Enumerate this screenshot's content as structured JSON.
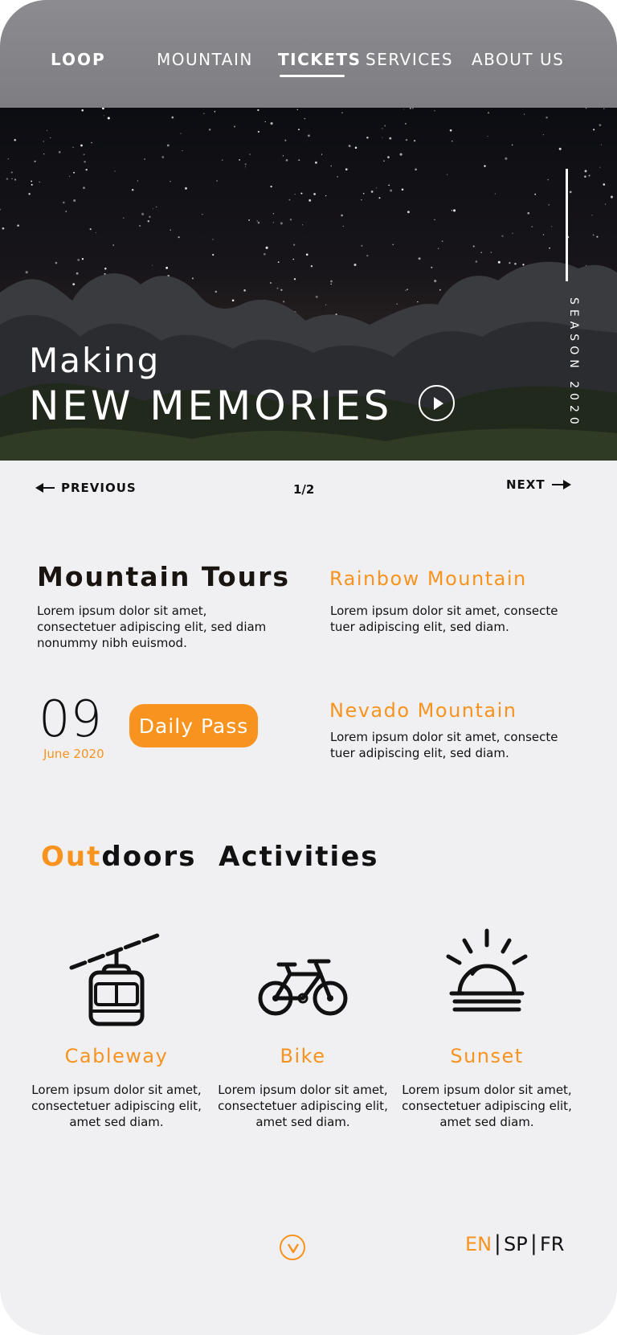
{
  "header": {
    "brand": "LOOP",
    "nav": [
      "MOUNTAIN",
      "TICKETS",
      "SERVICES",
      "ABOUT US"
    ],
    "active_nav": "TICKETS"
  },
  "hero": {
    "kicker": "Making",
    "title": "NEW MEMORIES",
    "season": "SEASON 2020"
  },
  "pager": {
    "previous": "PREVIOUS",
    "count": "1/2",
    "next": "NEXT"
  },
  "tours": {
    "title": "Mountain Tours",
    "text": "Lorem ipsum dolor sit amet, consectetuer adipiscing elit, sed diam nonummy nibh euismod.",
    "rainbow_title": "Rainbow Mountain",
    "rainbow_text": "Lorem ipsum dolor sit amet, consecte tuer adipiscing elit, sed diam.",
    "nevado_title": "Nevado Mountain",
    "nevado_text": "Lorem ipsum dolor sit amet, consecte tuer adipiscing elit, sed diam.",
    "date_day": "09",
    "date_month": "June 2020",
    "daily_pass": "Daily Pass"
  },
  "activities": {
    "heading_accent": "Out",
    "heading_rest": "doors  Activities",
    "items": [
      {
        "title": "Cableway",
        "text": "Lorem ipsum dolor sit amet, consectetuer adipiscing elit, amet sed diam.",
        "icon": "cable-car-icon"
      },
      {
        "title": "Bike",
        "text": "Lorem ipsum dolor sit amet, consectetuer adipiscing elit, amet sed diam.",
        "icon": "bike-icon"
      },
      {
        "title": "Sunset",
        "text": "Lorem ipsum dolor sit amet, consectetuer adipiscing elit, amet sed diam.",
        "icon": "sunset-icon"
      }
    ]
  },
  "footer": {
    "languages": [
      "EN",
      "SP",
      "FR"
    ],
    "active_language": "EN"
  },
  "colors": {
    "accent": "#f7931e",
    "background": "#f0f0f2",
    "header": "#838388"
  }
}
